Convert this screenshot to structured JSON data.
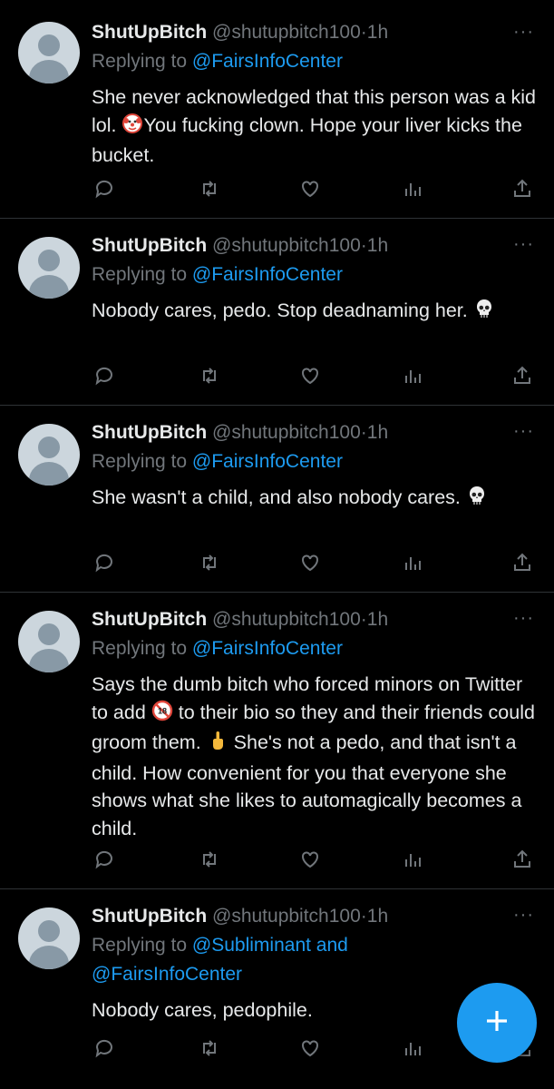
{
  "tweets": [
    {
      "name": "ShutUpBitch",
      "handle": "@shutupbitch100",
      "dot": "·",
      "time": "1h",
      "replying_prefix": "Replying to ",
      "replying_to": "@FairsInfoCenter",
      "replying_to_2": "",
      "text_before_emoji": "She never acknowledged that this person was a kid lol. ",
      "emoji": "clown-face-emoji",
      "text_after_emoji": "You fucking clown. Hope your liver kicks the bucket."
    },
    {
      "name": "ShutUpBitch",
      "handle": "@shutupbitch100",
      "dot": "·",
      "time": "1h",
      "replying_prefix": "Replying to ",
      "replying_to": "@FairsInfoCenter",
      "text_before_emoji": "Nobody cares, pedo. Stop deadnaming her. ",
      "emoji": "skull-emoji"
    },
    {
      "name": "ShutUpBitch",
      "handle": "@shutupbitch100",
      "dot": "·",
      "time": "1h",
      "replying_prefix": "Replying to ",
      "replying_to": "@FairsInfoCenter",
      "text_before_emoji": "She wasn't a child, and also nobody cares. ",
      "emoji": "skull-emoji"
    },
    {
      "name": "ShutUpBitch",
      "handle": "@shutupbitch100",
      "dot": "·",
      "time": "1h",
      "replying_prefix": "Replying to ",
      "replying_to": "@FairsInfoCenter",
      "text_part1": "Says the dumb bitch who forced minors on Twitter to add ",
      "emoji1": "no-one-under-eighteen-emoji",
      "text_part2": " to their bio so they and their friends could groom them. ",
      "emoji2": "middle-finger-emoji",
      "text_part3": " She's not a pedo, and that isn't a child. How convenient for you that everyone she shows what she likes to automagically becomes a child."
    },
    {
      "name": "ShutUpBitch",
      "handle": "@shutupbitch100",
      "dot": "·",
      "time": "1h",
      "replying_prefix": "Replying to ",
      "replying_to": "@Subliminant",
      "replying_and": " and",
      "replying_to_2": "@FairsInfoCenter",
      "text": "Nobody cares, pedophile."
    }
  ],
  "more_label": "···",
  "icons": {
    "reply": "reply-icon",
    "retweet": "retweet-icon",
    "like": "like-icon",
    "views": "views-icon",
    "share": "share-icon",
    "compose": "compose-plus-icon"
  },
  "colors": {
    "background": "#000000",
    "text": "#e7e9ea",
    "secondary": "#71767b",
    "mention": "#1d9bf0",
    "fab": "#1d9bf0",
    "divider": "#2f3336"
  }
}
